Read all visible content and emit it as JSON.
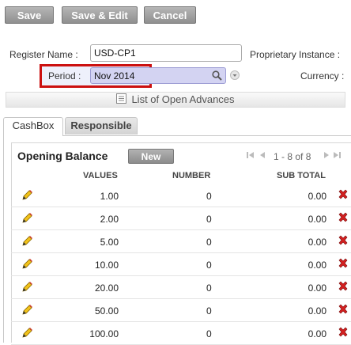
{
  "toolbar": {
    "save_label": "Save",
    "save_edit_label": "Save & Edit",
    "cancel_label": "Cancel"
  },
  "form": {
    "register_name_label": "Register Name :",
    "register_name_value": "USD-CP1",
    "proprietary_instance_label": "Proprietary Instance :",
    "period_label": "Period :",
    "period_value": "Nov 2014",
    "currency_label": "Currency :"
  },
  "open_advances_label": "List of Open Advances",
  "tabs": [
    {
      "label": "CashBox",
      "active": true
    },
    {
      "label": "Responsible",
      "active": false
    }
  ],
  "grid": {
    "title": "Opening Balance",
    "new_label": "New",
    "pager_text": "1 - 8 of 8",
    "columns": [
      "VALUES",
      "NUMBER",
      "SUB TOTAL"
    ],
    "rows": [
      {
        "value": "1.00",
        "number": "0",
        "subtotal": "0.00"
      },
      {
        "value": "2.00",
        "number": "0",
        "subtotal": "0.00"
      },
      {
        "value": "5.00",
        "number": "0",
        "subtotal": "0.00"
      },
      {
        "value": "10.00",
        "number": "0",
        "subtotal": "0.00"
      },
      {
        "value": "20.00",
        "number": "0",
        "subtotal": "0.00"
      },
      {
        "value": "50.00",
        "number": "0",
        "subtotal": "0.00"
      },
      {
        "value": "100.00",
        "number": "0",
        "subtotal": "0.00"
      }
    ]
  },
  "icons": {
    "search": "search-icon",
    "dropdown": "chevron-down-icon",
    "list": "list-icon",
    "edit": "pencil-icon",
    "delete": "delete-x-icon",
    "first": "first-page-icon",
    "prev": "prev-page-icon",
    "next": "next-page-icon",
    "last": "last-page-icon"
  },
  "colors": {
    "highlight_border": "#cc1010",
    "delete_red": "#d42020"
  }
}
